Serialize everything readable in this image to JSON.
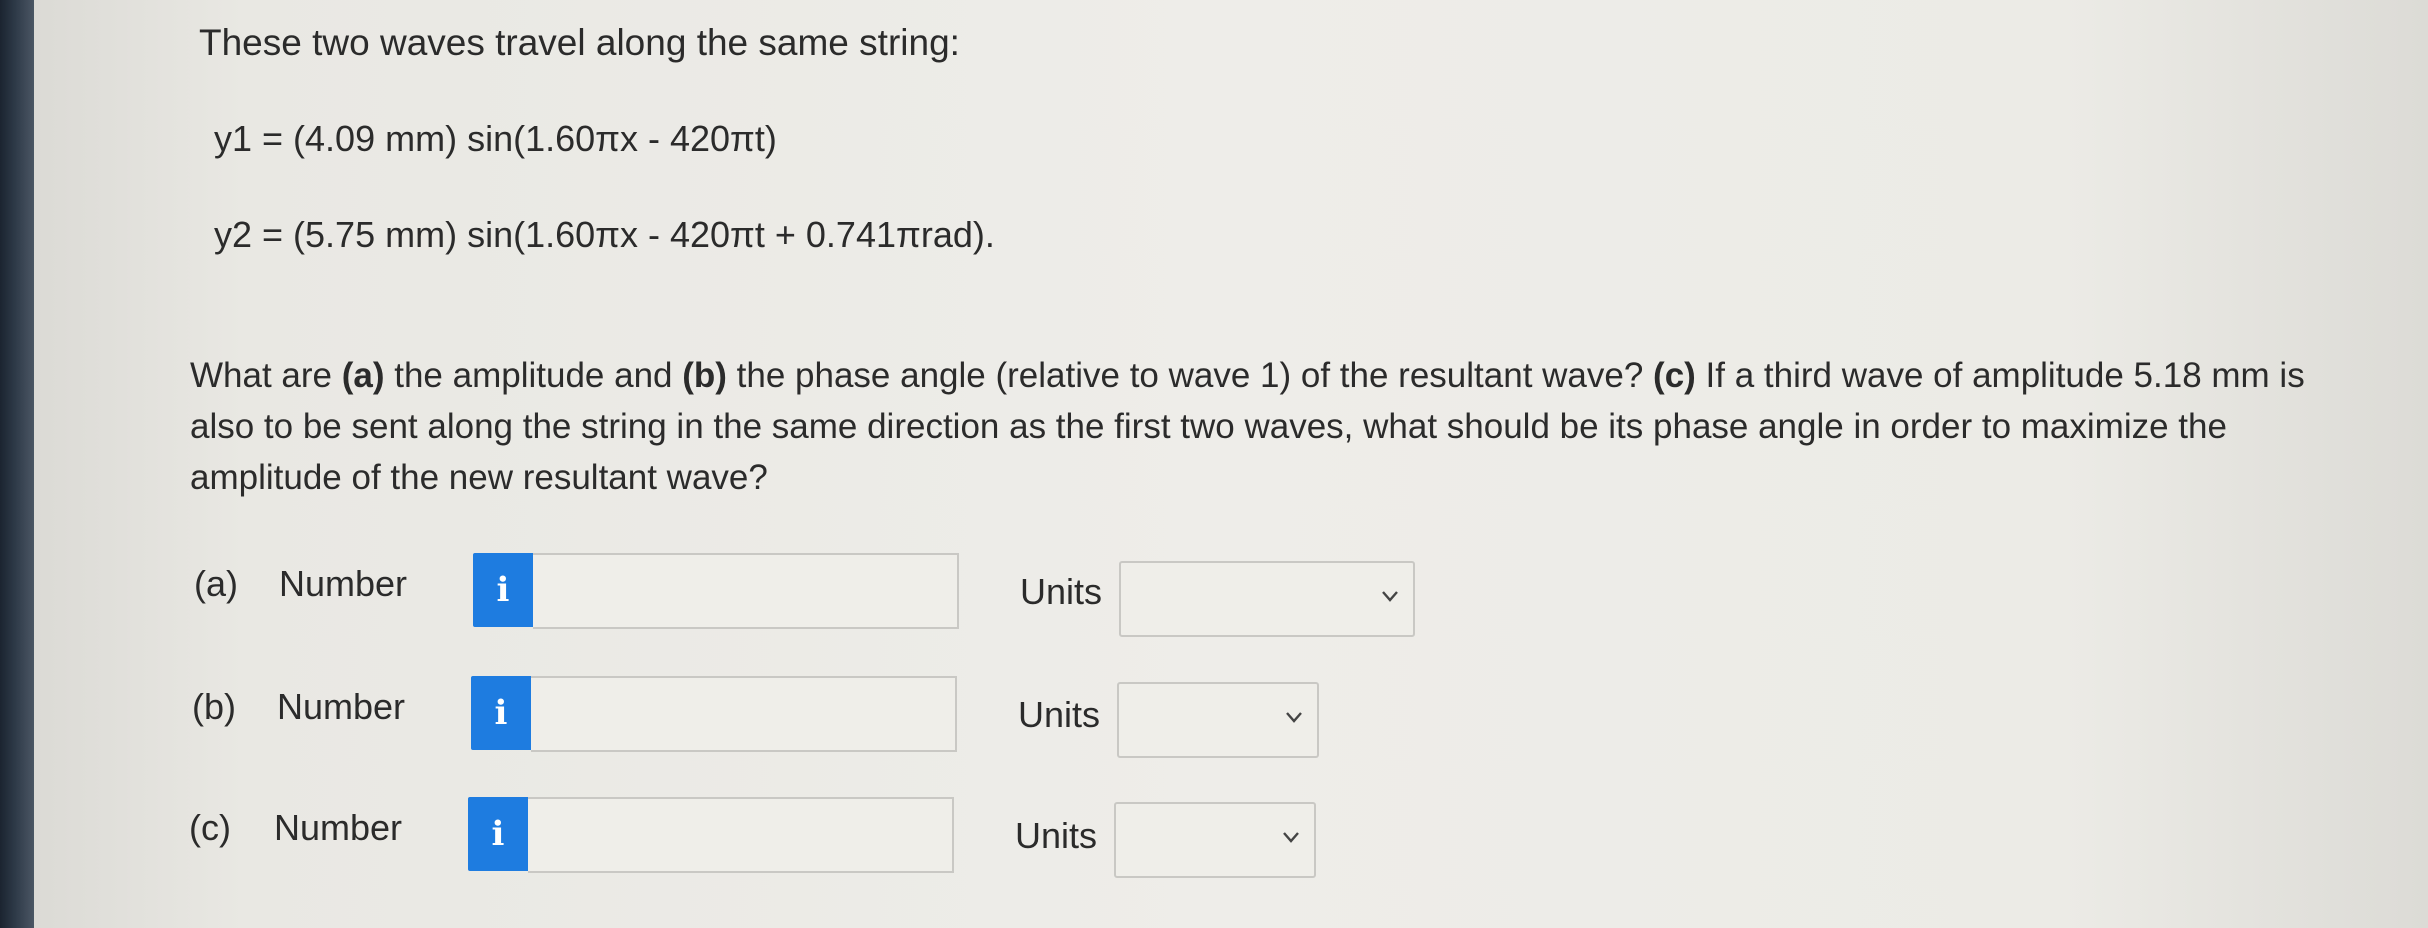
{
  "question": {
    "intro": "These two waves travel along the same string:",
    "equation_1": "y1 = (4.09 mm) sin(1.60πx - 420πt)",
    "equation_2": "y2 = (5.75 mm) sin(1.60πx - 420πt + 0.741πrad).",
    "body_parts": [
      "What are ",
      "(a)",
      " the amplitude and ",
      "(b)",
      " the phase angle (relative to wave 1) of the resultant wave? ",
      "(c)",
      " If a third wave of amplitude 5.18 mm is also to be sent along the string in the same direction as the first two waves, what should be its phase angle in order to maximize the amplitude of the new resultant wave?"
    ]
  },
  "answers": [
    {
      "part": "(a)",
      "number_label": "Number",
      "info_icon": "i",
      "value": "",
      "units_label": "Units",
      "units_selected": ""
    },
    {
      "part": "(b)",
      "number_label": "Number",
      "info_icon": "i",
      "value": "",
      "units_label": "Units",
      "units_selected": ""
    },
    {
      "part": "(c)",
      "number_label": "Number",
      "info_icon": "i",
      "value": "",
      "units_label": "Units",
      "units_selected": ""
    }
  ],
  "colors": {
    "info_button": "#1e7ce0",
    "background": "#eeede9",
    "text": "#2b2b2b"
  }
}
